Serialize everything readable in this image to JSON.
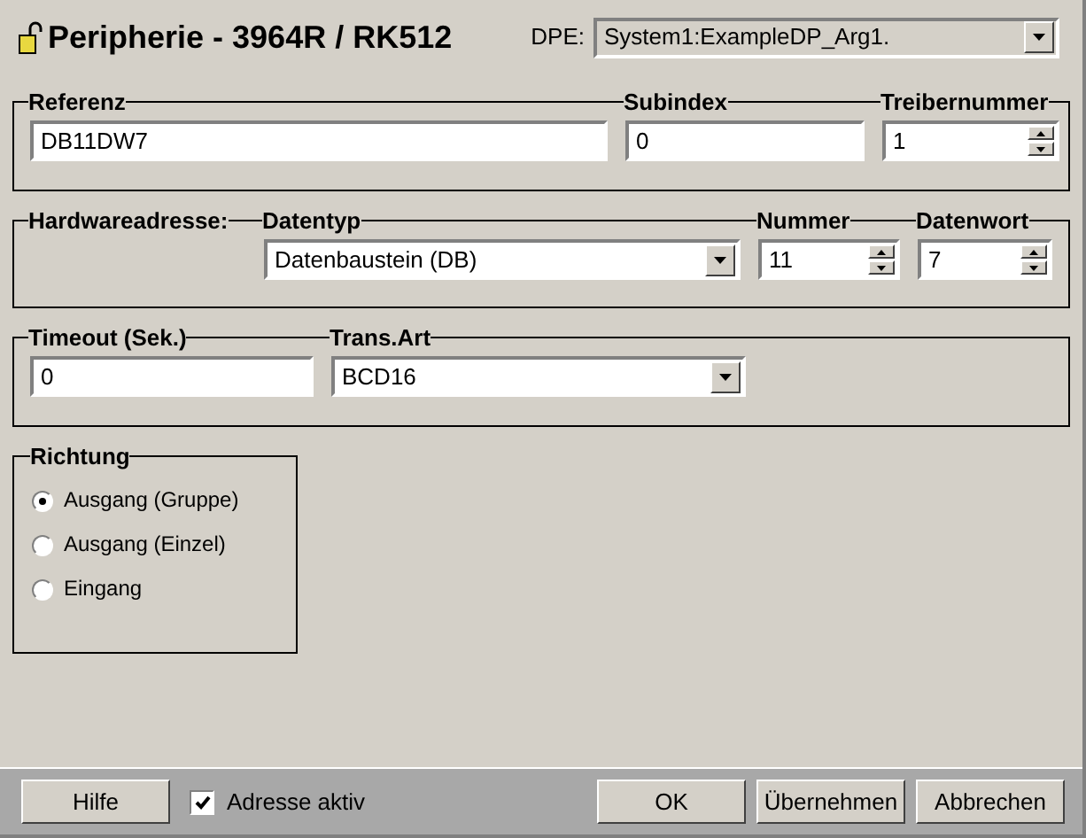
{
  "title": "Peripherie - 3964R / RK512",
  "dpe": {
    "label": "DPE:",
    "value": "System1:ExampleDP_Arg1."
  },
  "groups": [
    {
      "fields": [
        {
          "kind": "text",
          "label": "Referenz",
          "value": "DB11DW7"
        },
        {
          "kind": "text",
          "label": "Subindex",
          "value": "0"
        },
        {
          "kind": "spin",
          "label": "Treibernummer",
          "value": "1"
        }
      ]
    },
    {
      "fields": [
        {
          "kind": "caption",
          "label": "Hardwareadresse:"
        },
        {
          "kind": "combo",
          "label": "Datentyp",
          "value": "Datenbaustein (DB)"
        },
        {
          "kind": "spin",
          "label": "Nummer",
          "value": "11"
        },
        {
          "kind": "spin",
          "label": "Datenwort",
          "value": "7"
        }
      ]
    },
    {
      "fields": [
        {
          "kind": "text",
          "label": "Timeout (Sek.)",
          "value": "0"
        },
        {
          "kind": "combo",
          "label": "Trans.Art",
          "value": "BCD16"
        }
      ]
    }
  ],
  "direction": {
    "label": "Richtung",
    "options": [
      {
        "label": "Ausgang (Gruppe)",
        "selected": true
      },
      {
        "label": "Ausgang (Einzel)",
        "selected": false
      },
      {
        "label": "Eingang",
        "selected": false
      }
    ]
  },
  "footer": {
    "help": "Hilfe",
    "active": {
      "label": "Adresse aktiv",
      "checked": true
    },
    "buttons": [
      "OK",
      "Übernehmen",
      "Abbrechen"
    ]
  }
}
